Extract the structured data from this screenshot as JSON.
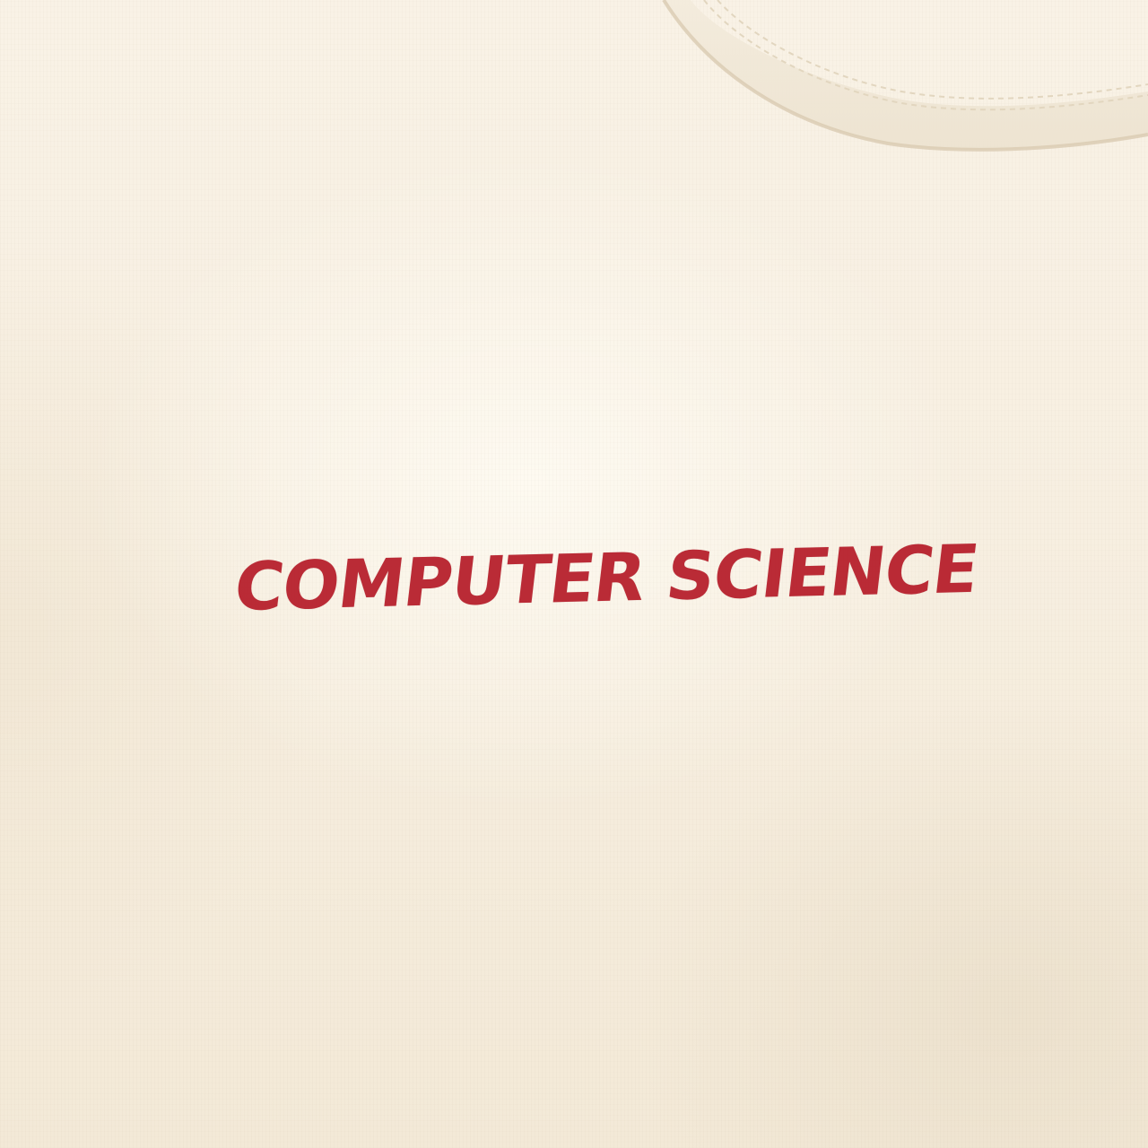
{
  "print": {
    "text": "COMPUTER SCIENCE",
    "color": "#b8232f"
  },
  "fabric": {
    "color": "#f6eedf"
  }
}
